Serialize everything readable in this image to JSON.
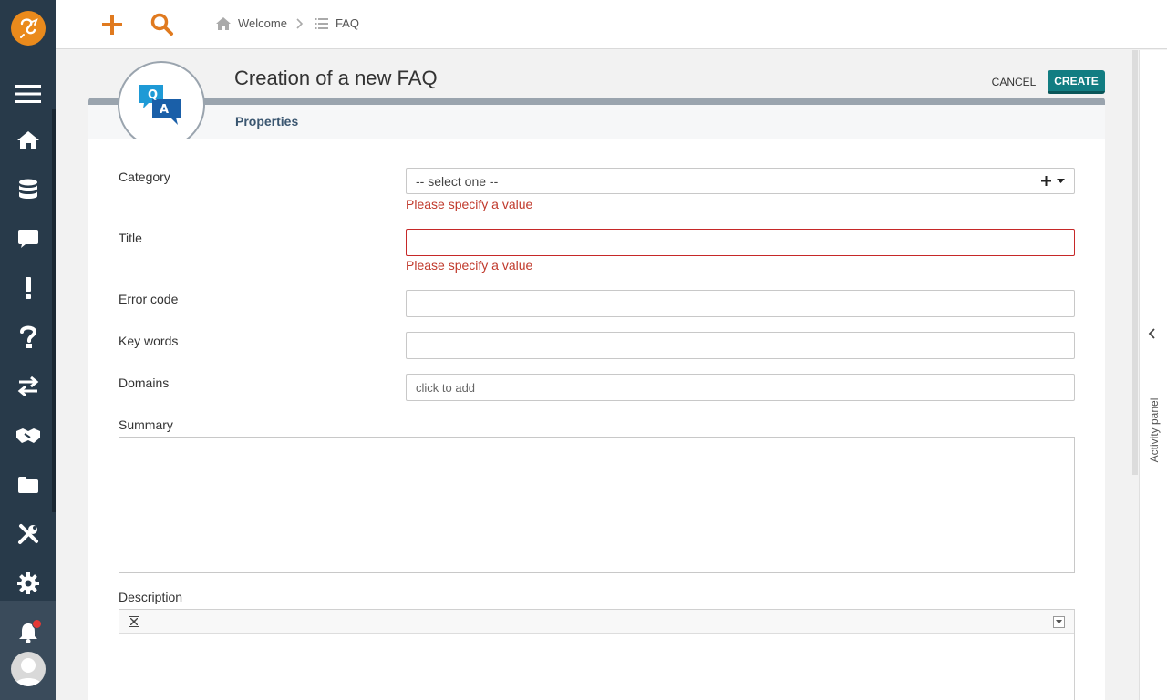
{
  "topbar": {
    "breadcrumb": [
      {
        "label": "Welcome",
        "icon": "home-icon"
      },
      {
        "label": "FAQ",
        "icon": "list-icon"
      }
    ]
  },
  "header": {
    "title": "Creation of a new FAQ",
    "tab": "Properties",
    "cancel_label": "CANCEL",
    "create_label": "CREATE",
    "icon_letters": {
      "q": "Q",
      "a": "A"
    }
  },
  "form": {
    "category": {
      "label": "Category",
      "value": "-- select one --",
      "error": "Please specify a value"
    },
    "title": {
      "label": "Title",
      "value": "",
      "error": "Please specify a value"
    },
    "error_code": {
      "label": "Error code",
      "value": ""
    },
    "key_words": {
      "label": "Key words",
      "value": ""
    },
    "domains": {
      "label": "Domains",
      "placeholder": "click to add"
    },
    "summary": {
      "label": "Summary"
    },
    "description": {
      "label": "Description"
    }
  },
  "activity_panel": {
    "label": "Activity panel"
  },
  "colors": {
    "sidebar": "#283a4a",
    "accent_orange": "#ea8a1c",
    "create_button": "#127d82",
    "error": "#c0392b"
  }
}
